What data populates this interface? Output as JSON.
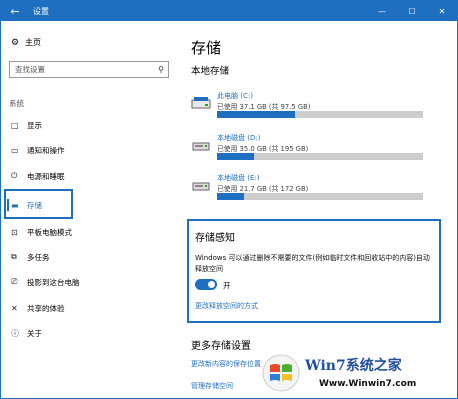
{
  "titlebar": {
    "back_icon": "←",
    "title": "设置",
    "minimize": "—",
    "maximize": "☐",
    "close": "✕"
  },
  "sidebar": {
    "home_label": "主页",
    "search_placeholder": "查找设置",
    "section_label": "系统",
    "items": [
      {
        "label": "显示",
        "icon": "□"
      },
      {
        "label": "通知和操作",
        "icon": "▭"
      },
      {
        "label": "电源和睡眠",
        "icon": "⏻"
      },
      {
        "label": "存储",
        "icon": "▬"
      },
      {
        "label": "平板电脑模式",
        "icon": "⊡"
      },
      {
        "label": "多任务",
        "icon": "⧉"
      },
      {
        "label": "投影到这台电脑",
        "icon": "⎚"
      },
      {
        "label": "共享的体验",
        "icon": "✕"
      },
      {
        "label": "关于",
        "icon": "ⓘ"
      }
    ]
  },
  "main": {
    "title": "存储",
    "local_storage_title": "本地存储",
    "drives": [
      {
        "name": "此电脑 (C:)",
        "usage": "已使用 37.1 GB (共 97.5 GB)",
        "fill": 0.38
      },
      {
        "name": "本地磁盘 (D:)",
        "usage": "已使用 35.0 GB (共 195 GB)",
        "fill": 0.18
      },
      {
        "name": "本地磁盘 (E:)",
        "usage": "已使用 21.7 GB (共 172 GB)",
        "fill": 0.13
      }
    ],
    "storage_sense": {
      "title": "存储感知",
      "description": "Windows 可以通过删除不需要的文件(例如临时文件和回收站中的内容)自动释放空间",
      "toggle_label": "开",
      "toggle_on": true,
      "link": "更改释放空间的方式"
    },
    "more_title": "更多存储设置",
    "more_links": [
      "更改新内容的保存位置",
      "管理存储空间"
    ]
  },
  "watermark": {
    "brand": "Win7系统之家",
    "url": "Www.Winwin7.com"
  },
  "colors": {
    "accent": "#1f6fc0",
    "bar_bg": "#cdcdcd"
  }
}
